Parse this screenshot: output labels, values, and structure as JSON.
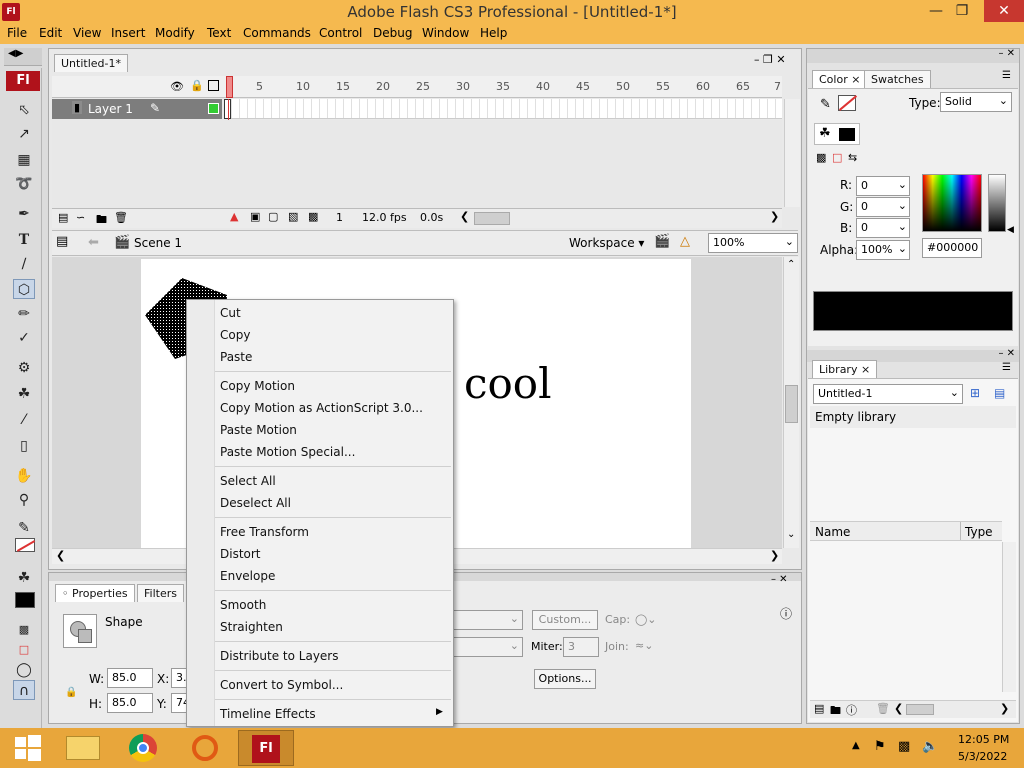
{
  "window": {
    "title": "Adobe Flash CS3 Professional - [Untitled-1*]",
    "app_icon": "Fl"
  },
  "menu": [
    "File",
    "Edit",
    "View",
    "Insert",
    "Modify",
    "Text",
    "Commands",
    "Control",
    "Debug",
    "Window",
    "Help"
  ],
  "document": {
    "tab": "Untitled-1*"
  },
  "timeline": {
    "layer_name": "Layer 1",
    "frame_numbers": [
      "5",
      "10",
      "15",
      "20",
      "25",
      "30",
      "35",
      "40",
      "45",
      "50",
      "55",
      "60",
      "65",
      "7"
    ],
    "current_frame": "1",
    "fps": "12.0 fps",
    "time": "0.0s"
  },
  "scene": {
    "name": "Scene 1",
    "workspace": "Workspace",
    "zoom": "100%"
  },
  "stage": {
    "text": "cool"
  },
  "properties": {
    "tabs": [
      "Properties",
      "Filters"
    ],
    "shape_label": "Shape",
    "w_label": "W:",
    "w_value": "85.0",
    "h_label": "H:",
    "h_value": "85.0",
    "x_label": "X:",
    "x_value": "3.",
    "y_label": "Y:",
    "y_value": "74",
    "custom_button": "Custom...",
    "cap_label": "Cap:",
    "miter_label": "Miter:",
    "miter_value": "3",
    "join_label": "Join:",
    "options_button": "Options..."
  },
  "color_panel": {
    "tabs": [
      "Color",
      "Swatches"
    ],
    "type_label": "Type:",
    "type_value": "Solid",
    "r_label": "R:",
    "r_value": "0",
    "g_label": "G:",
    "g_value": "0",
    "b_label": "B:",
    "b_value": "0",
    "alpha_label": "Alpha:",
    "alpha_value": "100%",
    "hex_value": "#000000",
    "preview_color": "#000000"
  },
  "library_panel": {
    "tab": "Library",
    "document": "Untitled-1",
    "status": "Empty library",
    "col_name": "Name",
    "col_type": "Type"
  },
  "context_menu": {
    "items": [
      "Cut",
      "Copy",
      "Paste",
      "Copy Motion",
      "Copy Motion as ActionScript 3.0...",
      "Paste Motion",
      "Paste Motion Special...",
      "Select All",
      "Deselect All",
      "Free Transform",
      "Distort",
      "Envelope",
      "Smooth",
      "Straighten",
      "Distribute to Layers",
      "Convert to Symbol...",
      "Timeline Effects"
    ]
  },
  "taskbar": {
    "time": "12:05 PM",
    "date": "5/3/2022",
    "flash_label": "Fl"
  }
}
